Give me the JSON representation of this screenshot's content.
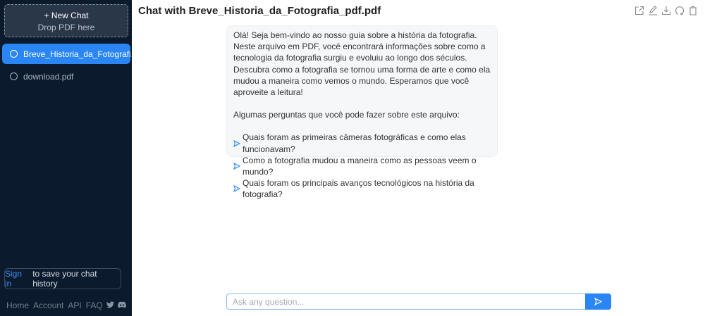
{
  "sidebar": {
    "new_chat_label": "New Chat",
    "drop_label": "Drop PDF here",
    "items": [
      {
        "label": "Breve_Historia_da_Fotografi..."
      },
      {
        "label": "download.pdf"
      }
    ],
    "signin_link": "Sign in",
    "signin_text": "to save your chat history",
    "footer": [
      "Home",
      "Account",
      "API",
      "FAQ"
    ]
  },
  "header": {
    "title": "Chat with Breve_Historia_da_Fotografia_pdf.pdf"
  },
  "message": {
    "intro": "Olá! Seja bem-vindo ao nosso guia sobre a história da fotografia. Neste arquivo em PDF, você encontrará informações sobre como a tecnologia da fotografia surgiu e evoluiu ao longo dos séculos. Descubra como a fotografia se tornou uma forma de arte e como ela mudou a maneira como vemos o mundo. Esperamos que você aproveite a leitura!",
    "prompt": "Algumas perguntas que você pode fazer sobre este arquivo:",
    "questions": [
      "Quais foram as primeiras câmeras fotográficas e como elas funcionavam?",
      "Como a fotografia mudou a maneira como as pessoas veem o mundo?",
      "Quais foram os principais avanços tecnológicos na história da fotografia?"
    ]
  },
  "input": {
    "placeholder": "Ask any question..."
  },
  "colors": {
    "accent": "#2a86f5",
    "sidebar": "#0c1a2d"
  }
}
